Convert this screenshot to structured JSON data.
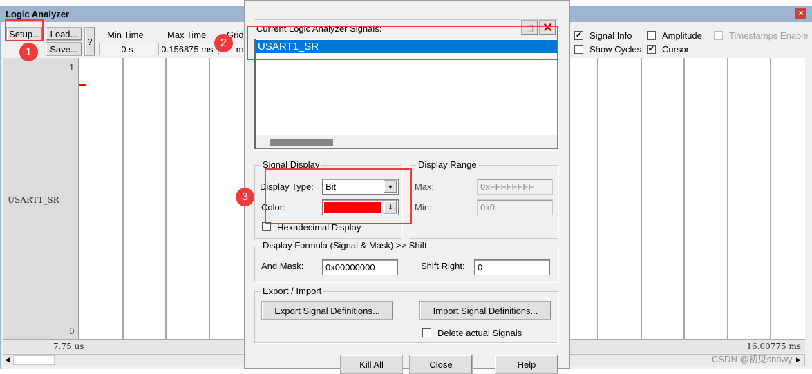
{
  "window": {
    "title": "Logic Analyzer",
    "close_icon": "close-icon"
  },
  "toolbar": {
    "setup": "Setup...",
    "load": "Load...",
    "save": "Save...",
    "help": "?",
    "min_time_label": "Min Time",
    "min_time_value": "0 s",
    "max_time_label": "Max Time",
    "max_time_value": "0.156875 ms",
    "grid_label": "Grid",
    "grid_value": "ms",
    "options": [
      {
        "label": "Signal Info",
        "checked": true,
        "enabled": true
      },
      {
        "label": "Amplitude",
        "checked": false,
        "enabled": true
      },
      {
        "label": "Timestamps Enable",
        "checked": false,
        "enabled": false
      },
      {
        "label": "Show Cycles",
        "checked": false,
        "enabled": true
      },
      {
        "label": "Cursor",
        "checked": true,
        "enabled": true
      }
    ]
  },
  "waveform": {
    "signal_name": "USART1_SR",
    "high_label": "1",
    "low_label": "0",
    "signal_color": "#ff0000",
    "time_start": "7.75 us",
    "time_end": "16.00775 ms"
  },
  "dialog": {
    "signals_label": "Current Logic Analyzer Signals:",
    "signals": [
      "USART1_SR"
    ],
    "new_icon": "new-signal-icon",
    "delete_icon": "delete-x-icon",
    "signal_display": {
      "title": "Signal Display",
      "display_type_label": "Display Type:",
      "display_type_value": "Bit",
      "color_label": "Color:",
      "color_value": "#ff0000",
      "hex_label": "Hexadecimal Display",
      "hex_checked": false
    },
    "display_range": {
      "title": "Display Range",
      "max_label": "Max:",
      "max_value": "0xFFFFFFFF",
      "min_label": "Min:",
      "min_value": "0x0"
    },
    "formula": {
      "title": "Display Formula (Signal & Mask) >> Shift",
      "mask_label": "And Mask:",
      "mask_value": "0x00000000",
      "shift_label": "Shift Right:",
      "shift_value": "0"
    },
    "export_import": {
      "title": "Export / Import",
      "export": "Export Signal Definitions...",
      "import": "Import Signal Definitions...",
      "delete_label": "Delete actual Signals",
      "delete_checked": false
    },
    "buttons": {
      "kill_all": "Kill All",
      "close": "Close",
      "help": "Help"
    }
  },
  "annotations": [
    "1",
    "2",
    "3"
  ],
  "watermark": "CSDN @初见snowy"
}
